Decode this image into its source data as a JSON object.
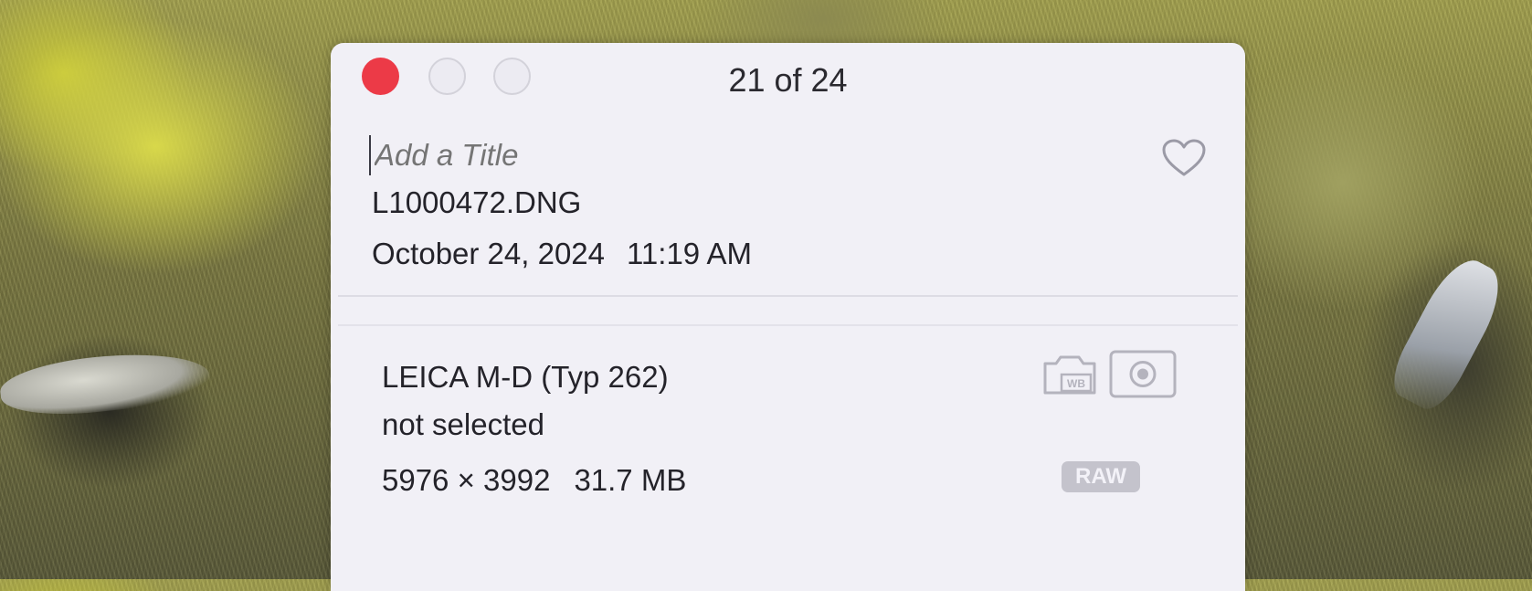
{
  "window": {
    "counter": "21 of 24"
  },
  "info": {
    "title_placeholder": "Add a Title",
    "filename": "L1000472.DNG",
    "date": "October 24, 2024",
    "time": "11:19 AM",
    "camera": "LEICA M-D (Typ 262)",
    "lens": "not selected",
    "dimensions": "5976 × 3992",
    "file_size": "31.7 MB",
    "format_badge": "RAW",
    "favorite": false
  },
  "icons": {
    "close": "close-button",
    "minimize": "minimize-button",
    "zoom": "zoom-button",
    "heart": "heart-icon",
    "white_balance": "white-balance-icon",
    "metering": "metering-icon"
  },
  "colors": {
    "close": "#ec3a47",
    "panel": "#f1f0f6",
    "text": "#24232a",
    "placeholder": "#a9a8b4",
    "icon_gray": "#b4b3bd"
  }
}
